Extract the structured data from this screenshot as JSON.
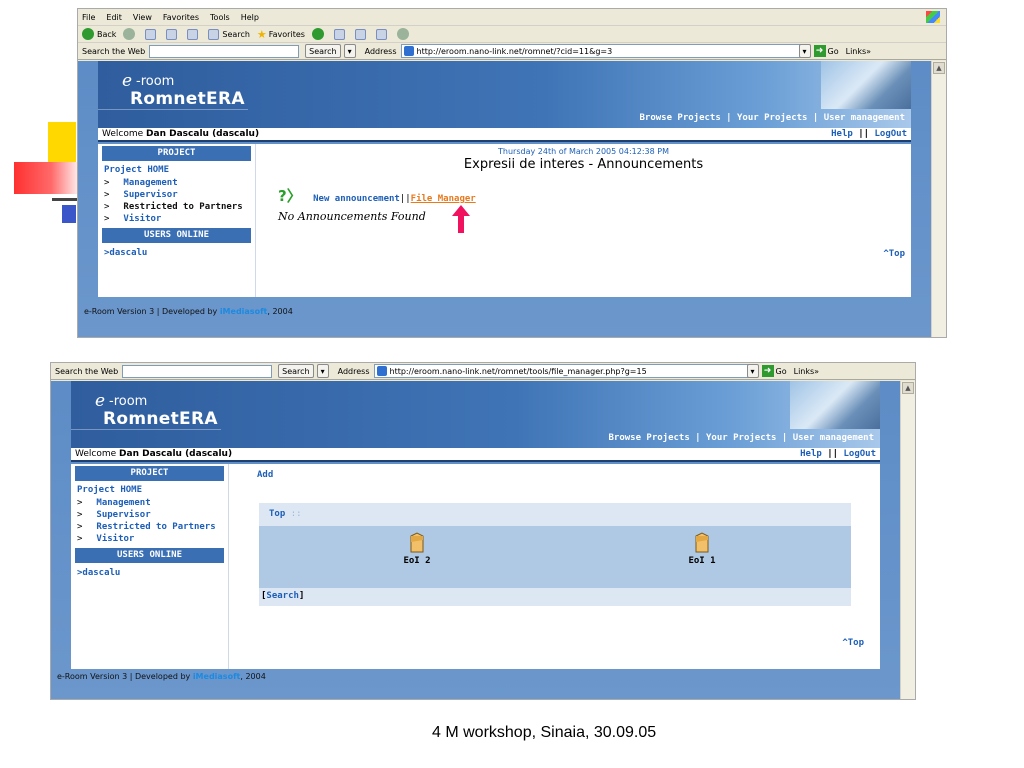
{
  "slide": {
    "caption": "4 M workshop, Sinaia, 30.09.05"
  },
  "browser1": {
    "menu": [
      "File",
      "Edit",
      "View",
      "Favorites",
      "Tools",
      "Help"
    ],
    "toolbar": {
      "back": "Back",
      "search": "Search",
      "favorites": "Favorites"
    },
    "search_web_label": "Search the Web",
    "search_button": "Search",
    "address_label": "Address",
    "url": "http://eroom.nano-link.net/romnet/?cid=11&g=3",
    "go_label": "Go",
    "links_label": "Links"
  },
  "browser2": {
    "search_web_label": "Search the Web",
    "search_button": "Search",
    "address_label": "Address",
    "url": "http://eroom.nano-link.net/romnet/tools/file_manager.php?g=15",
    "go_label": "Go",
    "links_label": "Links"
  },
  "site": {
    "logo_e": "e",
    "logo_room": "-room",
    "logo_name": "RomnetERA",
    "nav": "Browse Projects | Your Projects | User management",
    "welcome_prefix": "Welcome",
    "welcome_user": "Dan Dascalu (dascalu)",
    "help": "Help",
    "sep": "||",
    "logout": "LogOut",
    "sidebar": {
      "project_header": "PROJECT",
      "project_home": "Project HOME",
      "items": [
        "Management",
        "Supervisor",
        "Restricted to Partners",
        "Visitor"
      ],
      "users_header": "USERS ONLINE",
      "user": ">dascalu"
    },
    "footer_prefix": "e-Room Version 3 | Developed by",
    "footer_brand": "iMediasoft",
    "footer_suffix": ", 2004",
    "top_link": "^Top"
  },
  "page1": {
    "datetime": "Thursday 24th of March 2005 04:12:38 PM",
    "title": "Expresii de interes - Announcements",
    "new_announcement": "New announcement",
    "link_sep": "||",
    "file_manager": "File Manager",
    "empty": "No Announcements Found"
  },
  "page2": {
    "add": "Add",
    "breadcrumb": "Top",
    "breadcrumb_sep": "::",
    "folders": [
      "EoI 2",
      "EoI 1"
    ],
    "search_open": "[",
    "search": "Search",
    "search_close": "]"
  },
  "colors": {
    "header_blue": "#2f5d9d",
    "link_blue": "#1d5fb8",
    "file_manager_orange": "#e8791c",
    "arrow_pink": "#f0115f"
  }
}
